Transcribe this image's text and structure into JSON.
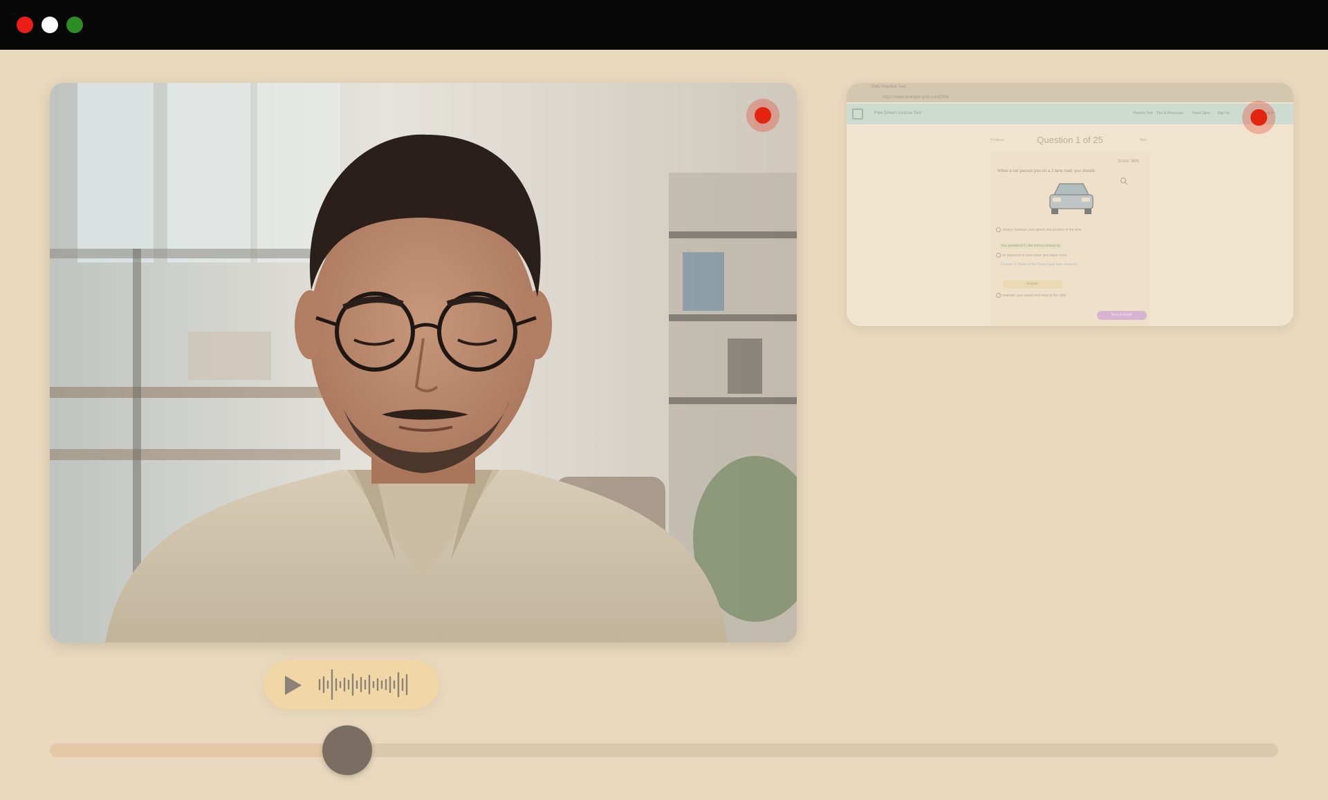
{
  "window": {
    "controls": [
      "close",
      "minimize",
      "maximize"
    ]
  },
  "colors": {
    "background": "#e9d8bd",
    "titlebar": "#080808",
    "recording": "#e3240f",
    "audio_pill": "#f2d7a6",
    "slider_thumb": "#7a6e63"
  },
  "webcam": {
    "recording_indicator": "recording-dot-icon"
  },
  "screen_share": {
    "tab_title": "DMV Practice Test",
    "url": "https://www.example-quiz.com/DMV",
    "brand": "Free Drivers License Test",
    "nav": [
      "Practice Test",
      "Tips & Resources",
      "Road Signs",
      "Sign Up",
      "Log In"
    ],
    "question_title": "Question 1 of 25",
    "prev_label": "Previous",
    "next_label": "Next",
    "score": "Score: 96%",
    "prompt": "When a car passes you on a 2 lane road, you should:",
    "options": [
      {
        "letter": "A",
        "text": "always maintain your speed and position in the lane"
      },
      {
        "letter": "B",
        "text": "be prepared to slow down and make room"
      },
      {
        "letter": "C",
        "text": "maintain your speed and keep to the right"
      }
    ],
    "feedback": "You answered C, the correct answer is",
    "reference_link": "Chapter 3: Rules of the Road (pass lane conduct)",
    "explain_button": "Explain",
    "next_question_button": "Next question"
  },
  "audio": {
    "play_icon": "play-icon",
    "waveform_icon": "waveform-icon"
  },
  "playback": {
    "progress": 0.242
  }
}
